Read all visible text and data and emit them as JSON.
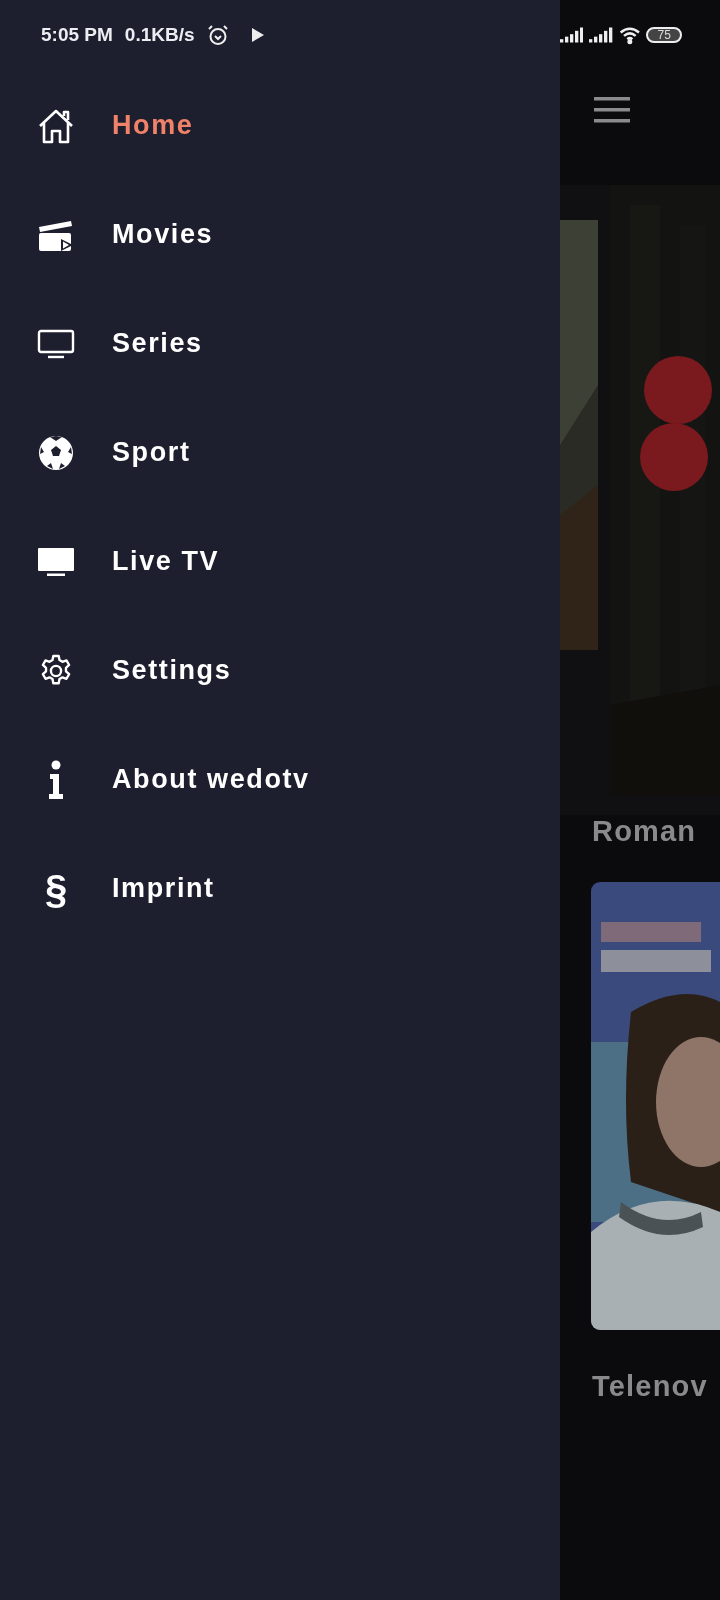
{
  "status_bar": {
    "time": "5:05 PM",
    "speed": "0.1KB/s",
    "battery": "75"
  },
  "drawer": {
    "items": [
      {
        "label": "Home",
        "selected": true,
        "kind": "home"
      },
      {
        "label": "Movies",
        "selected": false,
        "kind": "clapper"
      },
      {
        "label": "Series",
        "selected": false,
        "kind": "monitor"
      },
      {
        "label": "Sport",
        "selected": false,
        "kind": "ball"
      },
      {
        "label": "Live TV",
        "selected": false,
        "kind": "tv"
      },
      {
        "label": "Settings",
        "selected": false,
        "kind": "gear"
      },
      {
        "label": "About wedotv",
        "selected": false,
        "kind": "info"
      },
      {
        "label": "Imprint",
        "selected": false,
        "kind": "glyph",
        "glyph": "§"
      }
    ]
  },
  "content": {
    "sections": [
      {
        "title": "Roman"
      },
      {
        "title": "Telenov"
      }
    ]
  }
}
